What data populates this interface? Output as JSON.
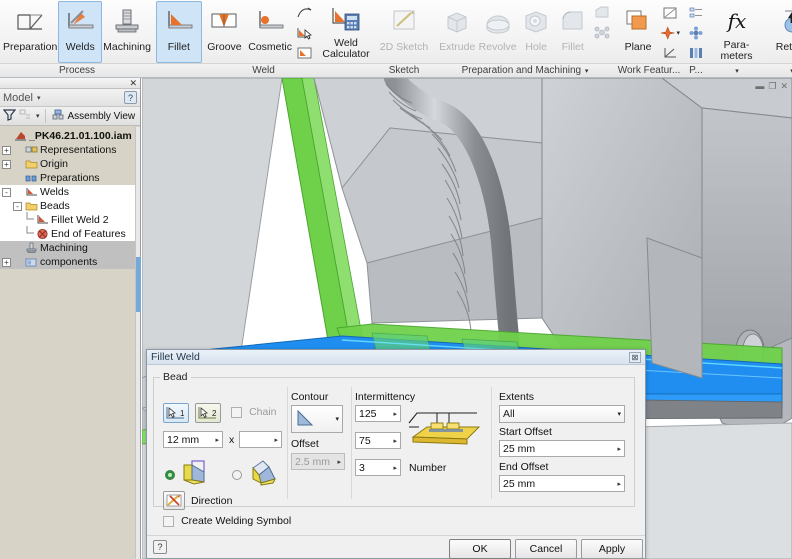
{
  "ribbon": {
    "groups": [
      {
        "title": "Process",
        "buttons": [
          {
            "label": "Preparation",
            "icon": "weld-preparation-icon",
            "state": "normal"
          },
          {
            "label": "Welds",
            "icon": "welds-icon",
            "state": "selected"
          },
          {
            "label": "Machining",
            "icon": "machining-icon",
            "state": "normal"
          }
        ]
      },
      {
        "title": "Weld",
        "buttons": [
          {
            "label": "Fillet",
            "icon": "fillet-weld-icon",
            "state": "selected"
          },
          {
            "label": "Groove",
            "icon": "groove-weld-icon",
            "state": "normal"
          },
          {
            "label": "Cosmetic",
            "icon": "cosmetic-weld-icon",
            "state": "normal"
          },
          {
            "label": "Weld Calculator",
            "icon": "weld-calculator-icon",
            "state": "normal",
            "dropdown": true
          }
        ],
        "small_buttons": [
          {
            "icon": "weld-curve-icon"
          },
          {
            "icon": "weld-select-icon"
          },
          {
            "icon": "weld-symbol-icon"
          }
        ]
      },
      {
        "title": "Sketch",
        "buttons": [
          {
            "label": "2D Sketch",
            "icon": "2d-sketch-icon",
            "state": "disabled"
          }
        ]
      },
      {
        "title": "Preparation and Machining",
        "has_title_dropdown": true,
        "buttons": [
          {
            "label": "Extrude",
            "icon": "extrude-icon",
            "state": "disabled"
          },
          {
            "label": "Revolve",
            "icon": "revolve-icon",
            "state": "disabled"
          },
          {
            "label": "Hole",
            "icon": "hole-icon",
            "state": "disabled"
          },
          {
            "label": "Fillet",
            "icon": "fillet-feature-icon",
            "state": "disabled"
          }
        ],
        "small_buttons": [
          {
            "icon": "chamfer-icon"
          },
          {
            "icon": "pattern-icon"
          }
        ]
      },
      {
        "title": "Work Featur...",
        "buttons": [
          {
            "label": "Plane",
            "icon": "work-plane-icon",
            "state": "normal"
          }
        ],
        "small_buttons": [
          {
            "icon": "work-plane-small-icon"
          },
          {
            "icon": "work-point-icon",
            "dropdown": true
          },
          {
            "icon": "work-axis-icon"
          }
        ]
      },
      {
        "title": "P...",
        "small_buttons": [
          {
            "icon": "parameter-list-icon"
          },
          {
            "icon": "material-icon"
          },
          {
            "icon": "ipart-icon"
          }
        ]
      },
      {
        "title": "",
        "has_title_dropdown": true,
        "buttons": [
          {
            "label": "Para- meters",
            "icon": "fx-parameters-icon",
            "state": "normal"
          }
        ]
      },
      {
        "title": "",
        "has_title_dropdown": true,
        "buttons": [
          {
            "label": "Return",
            "icon": "return-icon",
            "state": "normal"
          }
        ]
      }
    ]
  },
  "browser": {
    "close_glyph": "✕",
    "title": "Model",
    "caret": "▾",
    "help_glyph": "?",
    "toolbar": {
      "filter_icon": "filter-icon",
      "sort_icon": "sort-icon",
      "sort_caret": "▾",
      "assembly_view_icon": "assembly-view-icon",
      "assembly_view_label": "Assembly View"
    },
    "tree": [
      {
        "label": "_PK46.21.01.100.iam",
        "icon": "assembly-icon",
        "indent": 0,
        "expander": "",
        "bold": true,
        "highlight": "none"
      },
      {
        "label": "Representations",
        "icon": "representations-icon",
        "indent": 1,
        "expander": "+",
        "bold": false,
        "highlight": "none"
      },
      {
        "label": "Origin",
        "icon": "folder-icon",
        "indent": 1,
        "expander": "+",
        "bold": false,
        "highlight": "none"
      },
      {
        "label": "Preparations",
        "icon": "preparations-icon",
        "indent": 1,
        "expander": "",
        "bold": false,
        "highlight": "none"
      },
      {
        "label": "Welds",
        "icon": "welds-tree-icon",
        "indent": 1,
        "expander": "-",
        "bold": false,
        "highlight": "white"
      },
      {
        "label": "Beads",
        "icon": "beads-folder-icon",
        "indent": 2,
        "expander": "-",
        "bold": false,
        "highlight": "white"
      },
      {
        "label": "Fillet Weld 2",
        "icon": "fillet-weld-tree-icon",
        "indent": 3,
        "expander": "",
        "bold": false,
        "highlight": "white"
      },
      {
        "label": "End of Features",
        "icon": "end-of-features-icon",
        "indent": 3,
        "expander": "",
        "bold": false,
        "highlight": "white"
      },
      {
        "label": "Machining",
        "icon": "machining-tree-icon",
        "indent": 1,
        "expander": "",
        "bold": false,
        "highlight": "sel"
      },
      {
        "label": "components",
        "icon": "components-icon",
        "indent": 1,
        "expander": "+",
        "bold": false,
        "highlight": "sel"
      }
    ]
  },
  "viewport": {
    "window_controls": [
      "minimize-icon",
      "restore-icon",
      "close-icon"
    ],
    "minimize_glyph": "▬",
    "restore_glyph": "❐",
    "close_glyph": "✕",
    "colors": {
      "body_gray": "#b9bcc0",
      "highlight_green": "#6fd14a",
      "selection_blue": "#1f8ef0",
      "background": "#ffffff"
    }
  },
  "dialog": {
    "title": "Fillet Weld",
    "close_glyph": "⊠",
    "bead_group": {
      "legend": "Bead",
      "select1_label": "1",
      "select1_icon": "cursor-select-1-icon",
      "select2_label": "2",
      "select2_icon": "cursor-select-2-icon",
      "chain_label": "Chain",
      "size1_value": "12 mm",
      "size_separator": "x",
      "size2_value": "",
      "spin_glyph": "▸",
      "direction_label": "Direction",
      "direction_icon": "weld-direction-icon",
      "option1_icon": "weld-normal-icon",
      "option2_icon": "weld-angled-icon"
    },
    "contour_group": {
      "label": "Contour",
      "contour_icon": "contour-triangle-icon",
      "caret": "▾",
      "offset_label": "Offset",
      "offset_value": "2.5 mm",
      "offset_enabled": false
    },
    "intermittency_group": {
      "label": "Intermittency",
      "length_value": "125",
      "pitch_value": "75",
      "number_value": "3",
      "number_label": "Number",
      "preview_icon": "intermittent-weld-preview-icon"
    },
    "extents_group": {
      "label": "Extents",
      "extents_value": "All",
      "caret": "▾",
      "start_offset_label": "Start Offset",
      "start_offset_value": "25 mm",
      "end_offset_label": "End Offset",
      "end_offset_value": "25 mm"
    },
    "create_welding_symbol_label": "Create Welding Symbol",
    "create_welding_symbol_checked": false,
    "help_glyph": "?",
    "buttons": {
      "ok": "OK",
      "cancel": "Cancel",
      "apply": "Apply"
    }
  }
}
